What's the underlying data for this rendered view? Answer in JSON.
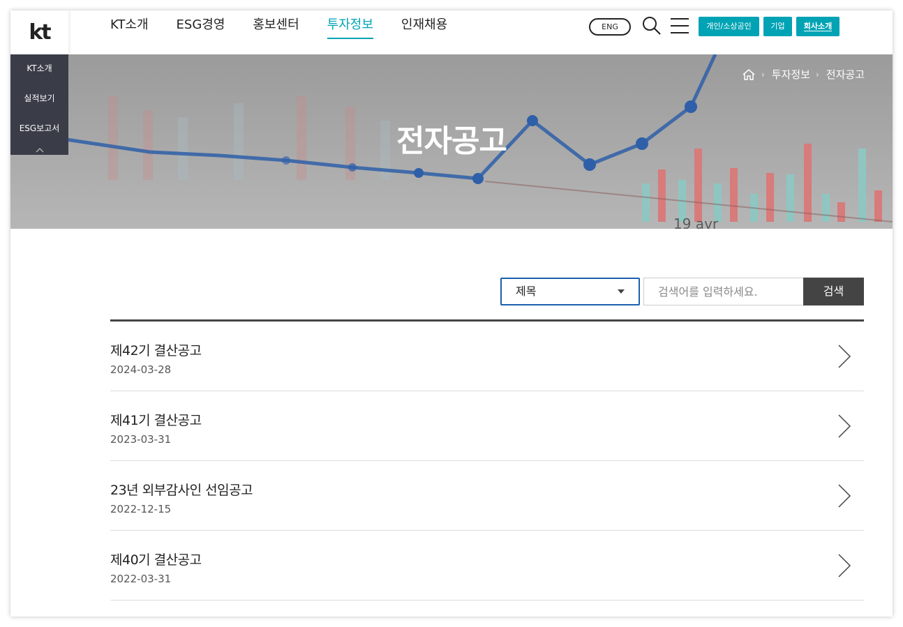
{
  "logo": "kt",
  "gnb": [
    "KT소개",
    "ESG경영",
    "홍보센터",
    "투자정보",
    "인재채용"
  ],
  "lang_label": "ENG",
  "segments": [
    "개인/소상공인",
    "기업",
    "회사소개"
  ],
  "quick_menu": [
    "KT소개",
    "실적보기",
    "ESG보고서"
  ],
  "breadcrumb": [
    "투자정보",
    "전자공고"
  ],
  "hero": {
    "title": "전자공고",
    "bg_text": "19 avr"
  },
  "search": {
    "select_value": "제목",
    "placeholder": "검색어를 입력하세요.",
    "button": "검색"
  },
  "notices": [
    {
      "title": "제42기 결산공고",
      "date": "2024-03-28"
    },
    {
      "title": "제41기 결산공고",
      "date": "2023-03-31"
    },
    {
      "title": "23년 외부감사인 선임공고",
      "date": "2022-12-15"
    },
    {
      "title": "제40기 결산공고",
      "date": "2022-03-31"
    }
  ],
  "colors": {
    "accent": "#00a3b4",
    "select_border": "#1c5fae",
    "dark_button": "#444444",
    "quick_menu_bg": "#3a3d48"
  }
}
